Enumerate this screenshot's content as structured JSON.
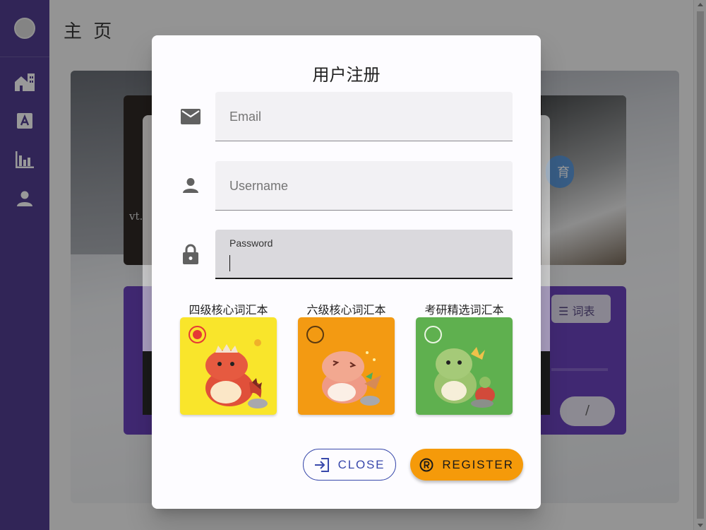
{
  "app": {
    "page_title": "主 页",
    "background_card_text": "vt.",
    "background_chip_text": "育",
    "background_vocab_chip": "词表",
    "background_pill_text": "/"
  },
  "colors": {
    "sidebar": "#3f2a86",
    "dialog_bg": "#fdfcff",
    "accent_blue": "#3949ab",
    "register_orange": "#f59a0a",
    "cet4_card": "#f9e52b",
    "cet6_card": "#f39a12",
    "postgrad_card": "#5fb04f",
    "radio_selected": "#e53935"
  },
  "sidebar": {
    "items": [
      {
        "icon": "building-icon"
      },
      {
        "icon": "letter-a-icon"
      },
      {
        "icon": "bar-chart-icon"
      },
      {
        "icon": "person-icon"
      }
    ]
  },
  "dialog": {
    "title": "用户注册",
    "email": {
      "icon": "mail-icon",
      "placeholder": "Email",
      "value": ""
    },
    "username": {
      "icon": "person-icon",
      "placeholder": "Username",
      "value": ""
    },
    "password": {
      "icon": "lock-icon",
      "label": "Password",
      "value": "",
      "focused": true
    },
    "vocab_books": [
      {
        "label": "四级核心词汇本",
        "selected": true
      },
      {
        "label": "六级核心词汇本",
        "selected": false
      },
      {
        "label": "考研精选词汇本",
        "selected": false
      }
    ],
    "close_button": {
      "label": "CLOSE",
      "icon": "login-arrow-icon"
    },
    "register_button": {
      "label": "REGISTER",
      "icon": "registered-icon"
    }
  }
}
